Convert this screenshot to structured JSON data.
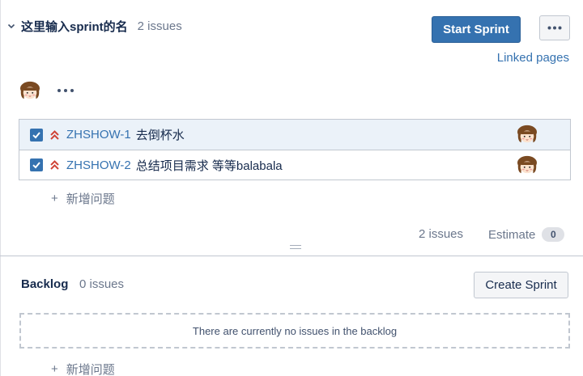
{
  "sprint": {
    "name": "这里输入sprint的名",
    "issue_count": "2 issues",
    "start_button": "Start Sprint",
    "linked_pages": "Linked pages",
    "issues": [
      {
        "key": "ZHSHOW-1",
        "summary": "去倒杯水",
        "selected": true,
        "checked": true,
        "priority": "highest"
      },
      {
        "key": "ZHSHOW-2",
        "summary": "总结项目需求 等等balabala",
        "selected": false,
        "checked": true,
        "priority": "highest"
      }
    ],
    "add_issue": "新增问题",
    "footer": {
      "count": "2 issues",
      "estimate_label": "Estimate",
      "estimate_value": "0"
    }
  },
  "backlog": {
    "title": "Backlog",
    "count": "0 issues",
    "create_button": "Create Sprint",
    "empty_text": "There are currently no issues in the backlog",
    "add_issue": "新增问题"
  },
  "colors": {
    "primary": "#3572b0",
    "link": "#3572b0",
    "priority": "#d04437",
    "muted": "#6b778c"
  },
  "icons": [
    "chevron-down-icon",
    "more-icon",
    "avatar-icon",
    "checkbox-icon",
    "highest-priority-icon",
    "plus-icon"
  ]
}
